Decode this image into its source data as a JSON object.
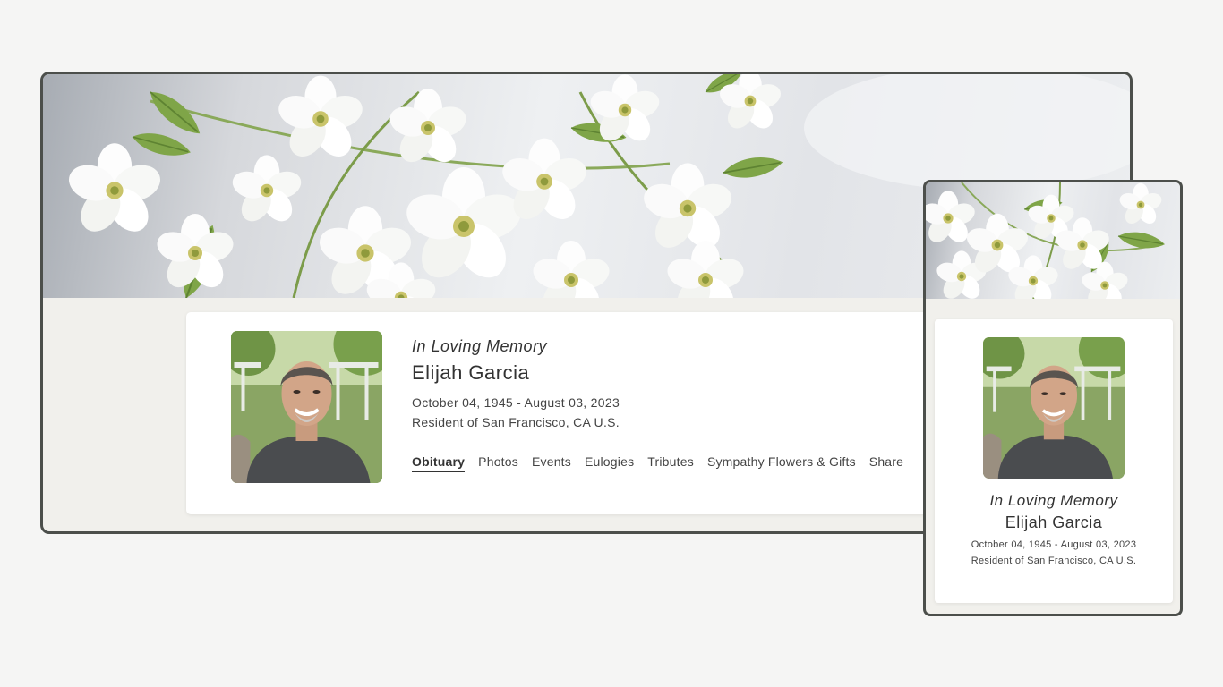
{
  "memorial": {
    "heading": "In Loving Memory",
    "name": "Elijah Garcia",
    "dates": "October 04, 1945 - August 03, 2023",
    "residence": "Resident of San Francisco, CA U.S."
  },
  "nav": {
    "tabs": [
      {
        "label": "Obituary",
        "active": true
      },
      {
        "label": "Photos"
      },
      {
        "label": "Events"
      },
      {
        "label": "Eulogies"
      },
      {
        "label": "Tributes"
      },
      {
        "label": "Sympathy Flowers & Gifts"
      },
      {
        "label": "Share"
      }
    ]
  },
  "images": {
    "banner": "white-cherry-blossom-banner",
    "portrait": "smiling-man-portrait"
  },
  "colors": {
    "frame_border": "#4c4f4b",
    "page_bg": "#f1f0ec",
    "card_bg": "#ffffff",
    "text": "#333333"
  }
}
